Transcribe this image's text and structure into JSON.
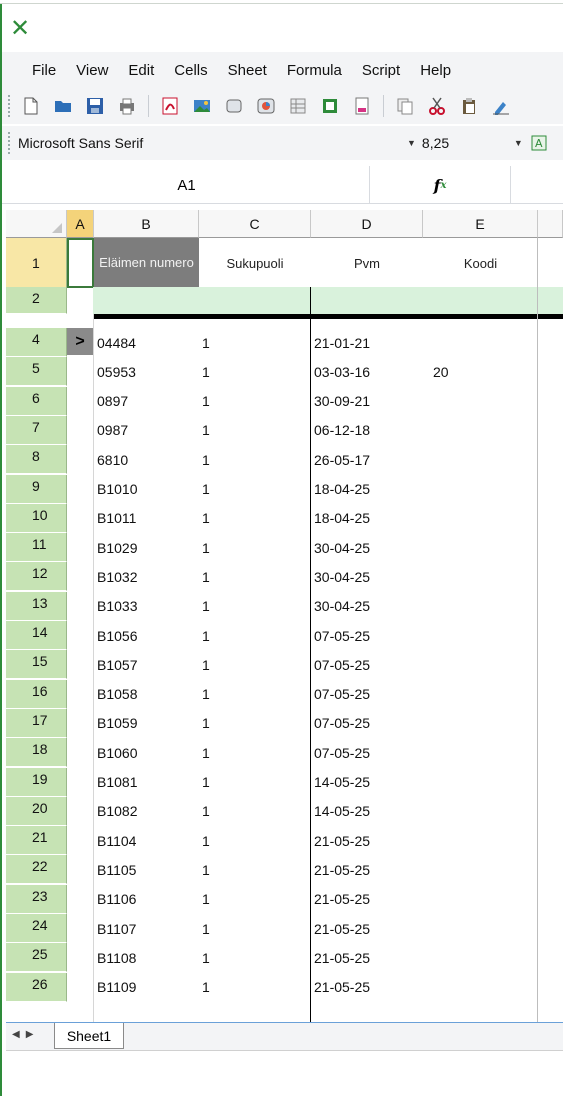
{
  "app": {
    "logo_glyph": "✕",
    "accent": "#2e8b3a"
  },
  "menu": [
    "File",
    "View",
    "Edit",
    "Cells",
    "Sheet",
    "Formula",
    "Script",
    "Help"
  ],
  "toolbar_icons": [
    "new-file-icon",
    "open-folder-icon",
    "save-icon",
    "print-icon",
    "pdf-icon",
    "image-icon",
    "shape-icon",
    "chart-icon",
    "table-icon",
    "template-icon",
    "sheet-icon",
    "copy-icon",
    "cut-icon",
    "paste-icon",
    "format-painter-icon"
  ],
  "font": {
    "name": "Microsoft Sans Serif",
    "size": "8,25"
  },
  "formula_bar": {
    "cell_ref": "A1",
    "fx_label": "f",
    "fx_sub": "x"
  },
  "columns": [
    "A",
    "B",
    "C",
    "D",
    "E"
  ],
  "header_row": {
    "row": "1",
    "B": "Eläimen numero",
    "C": "Sukupuoli",
    "D": "Pvm",
    "E": "Koodi"
  },
  "rows": [
    {
      "n": "2",
      "B": "",
      "C": "",
      "D": "",
      "E": ""
    },
    {
      "n": "4",
      "B": "04484",
      "C": "1",
      "D": "21-01-21",
      "E": ""
    },
    {
      "n": "5",
      "B": "05953",
      "C": "1",
      "D": "03-03-16",
      "E": "20"
    },
    {
      "n": "6",
      "B": "0897",
      "C": "1",
      "D": "30-09-21",
      "E": ""
    },
    {
      "n": "7",
      "B": "0987",
      "C": "1",
      "D": "06-12-18",
      "E": ""
    },
    {
      "n": "8",
      "B": "6810",
      "C": "1",
      "D": "26-05-17",
      "E": ""
    },
    {
      "n": "9",
      "B": "B1010",
      "C": "1",
      "D": "18-04-25",
      "E": ""
    },
    {
      "n": "10",
      "B": "B1011",
      "C": "1",
      "D": "18-04-25",
      "E": ""
    },
    {
      "n": "11",
      "B": "B1029",
      "C": "1",
      "D": "30-04-25",
      "E": ""
    },
    {
      "n": "12",
      "B": "B1032",
      "C": "1",
      "D": "30-04-25",
      "E": ""
    },
    {
      "n": "13",
      "B": "B1033",
      "C": "1",
      "D": "30-04-25",
      "E": ""
    },
    {
      "n": "14",
      "B": "B1056",
      "C": "1",
      "D": "07-05-25",
      "E": ""
    },
    {
      "n": "15",
      "B": "B1057",
      "C": "1",
      "D": "07-05-25",
      "E": ""
    },
    {
      "n": "16",
      "B": "B1058",
      "C": "1",
      "D": "07-05-25",
      "E": ""
    },
    {
      "n": "17",
      "B": "B1059",
      "C": "1",
      "D": "07-05-25",
      "E": ""
    },
    {
      "n": "18",
      "B": "B1060",
      "C": "1",
      "D": "07-05-25",
      "E": ""
    },
    {
      "n": "19",
      "B": "B1081",
      "C": "1",
      "D": "14-05-25",
      "E": ""
    },
    {
      "n": "20",
      "B": "B1082",
      "C": "1",
      "D": "14-05-25",
      "E": ""
    },
    {
      "n": "21",
      "B": "B1104",
      "C": "1",
      "D": "21-05-25",
      "E": ""
    },
    {
      "n": "22",
      "B": "B1105",
      "C": "1",
      "D": "21-05-25",
      "E": ""
    },
    {
      "n": "23",
      "B": "B1106",
      "C": "1",
      "D": "21-05-25",
      "E": ""
    },
    {
      "n": "24",
      "B": "B1107",
      "C": "1",
      "D": "21-05-25",
      "E": ""
    },
    {
      "n": "25",
      "B": "B1108",
      "C": "1",
      "D": "21-05-25",
      "E": ""
    },
    {
      "n": "26",
      "B": "B1109",
      "C": "1",
      "D": "21-05-25",
      "E": ""
    }
  ],
  "current_row_marker": ">",
  "sheet_tabs": [
    "Sheet1"
  ],
  "colors": {
    "row_header": "#c6e3b4",
    "row2_fill": "#d9f2dc",
    "header_b_fill": "#7d7d7d"
  }
}
